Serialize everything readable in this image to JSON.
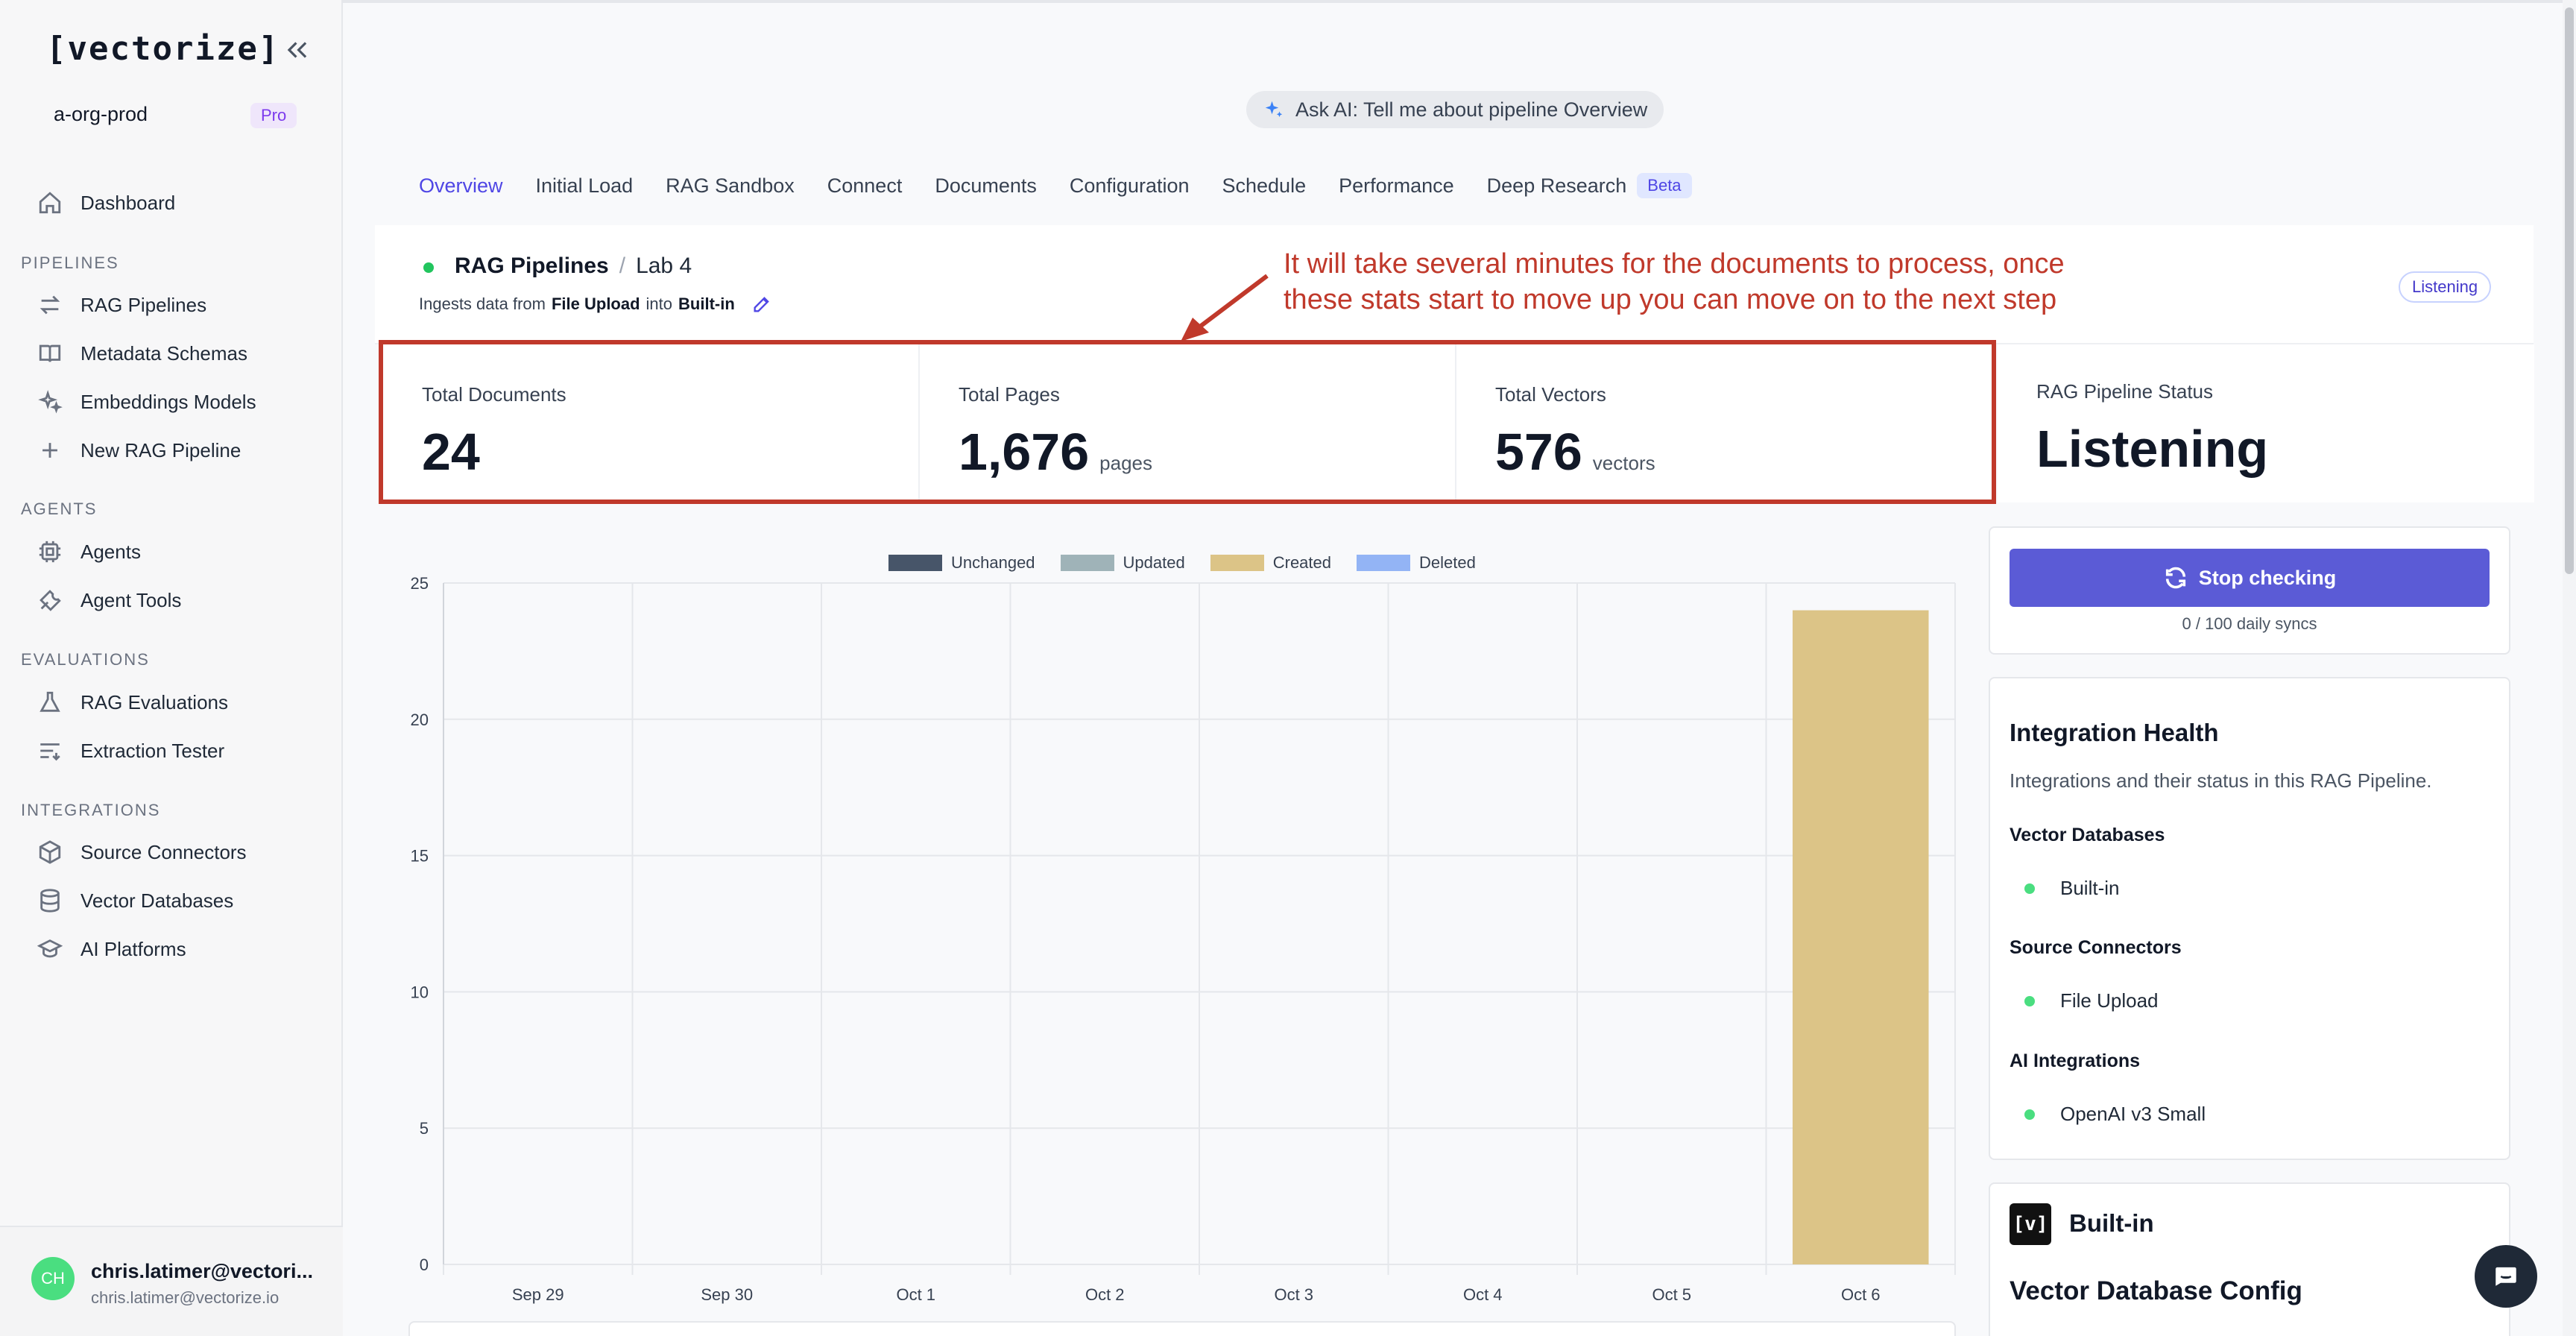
{
  "sidebar": {
    "logo": "[vectorize]",
    "org": "a-org-prod",
    "plan_badge": "Pro",
    "dashboard": "Dashboard",
    "sections": {
      "pipelines": "PIPELINES",
      "agents": "AGENTS",
      "evaluations": "EVALUATIONS",
      "integrations": "INTEGRATIONS"
    },
    "items": {
      "rag_pipelines": "RAG Pipelines",
      "metadata_schemas": "Metadata Schemas",
      "embeddings_models": "Embeddings Models",
      "new_rag_pipeline": "New RAG Pipeline",
      "agents": "Agents",
      "agent_tools": "Agent Tools",
      "rag_evaluations": "RAG Evaluations",
      "extraction_tester": "Extraction Tester",
      "source_connectors": "Source Connectors",
      "vector_databases": "Vector Databases",
      "ai_platforms": "AI Platforms"
    },
    "user": {
      "initials": "CH",
      "name": "chris.latimer@vectori...",
      "email": "chris.latimer@vectorize.io"
    }
  },
  "ask_ai": "Ask AI: Tell me about pipeline Overview",
  "tabs": [
    "Overview",
    "Initial Load",
    "RAG Sandbox",
    "Connect",
    "Documents",
    "Configuration",
    "Schedule",
    "Performance",
    "Deep Research"
  ],
  "beta_badge": "Beta",
  "header": {
    "crumb_root": "RAG Pipelines",
    "crumb_sep": "/",
    "crumb_leaf": "Lab 4",
    "ingests_prefix": "Ingests data from",
    "ingests_source": "File Upload",
    "ingests_mid": "into",
    "ingests_target": "Built-in",
    "status_badge": "Listening"
  },
  "annotation": {
    "line1": "It will take several minutes for the documents to process, once",
    "line2": "these stats start to move up you can move on to the next step",
    "color": "#c0392b"
  },
  "stats": {
    "documents_label": "Total Documents",
    "documents_value": "24",
    "pages_label": "Total Pages",
    "pages_value": "1,676",
    "pages_unit": "pages",
    "vectors_label": "Total Vectors",
    "vectors_value": "576",
    "vectors_unit": "vectors",
    "status_label": "RAG Pipeline Status",
    "status_value": "Listening"
  },
  "chart_data": {
    "type": "bar",
    "categories": [
      "Sep 29",
      "Sep 30",
      "Oct 1",
      "Oct 2",
      "Oct 3",
      "Oct 4",
      "Oct 5",
      "Oct 6"
    ],
    "series": [
      {
        "name": "Unchanged",
        "color": "#475569",
        "values": [
          0,
          0,
          0,
          0,
          0,
          0,
          0,
          0
        ]
      },
      {
        "name": "Updated",
        "color": "#9fb3b8",
        "values": [
          0,
          0,
          0,
          0,
          0,
          0,
          0,
          0
        ]
      },
      {
        "name": "Created",
        "color": "#dcc487",
        "values": [
          0,
          0,
          0,
          0,
          0,
          0,
          0,
          24
        ]
      },
      {
        "name": "Deleted",
        "color": "#93b4f5",
        "values": [
          0,
          0,
          0,
          0,
          0,
          0,
          0,
          0
        ]
      }
    ],
    "stacked": true,
    "yticks": [
      "0",
      "5",
      "10",
      "15",
      "20",
      "25"
    ],
    "ylim": [
      0,
      25
    ],
    "grid": true,
    "legend": "top-center"
  },
  "panel": {
    "stop_button": "Stop checking",
    "syncs": "0 / 100 daily syncs",
    "health_title": "Integration Health",
    "health_sub": "Integrations and their status in this RAG Pipeline.",
    "vector_db_heading": "Vector Databases",
    "vector_db_item": "Built-in",
    "source_heading": "Source Connectors",
    "source_item": "File Upload",
    "ai_heading": "AI Integrations",
    "ai_item": "OpenAI v3 Small",
    "builtin_logo": "[v]",
    "builtin_title": "Built-in",
    "vdc_title": "Vector Database Config"
  }
}
